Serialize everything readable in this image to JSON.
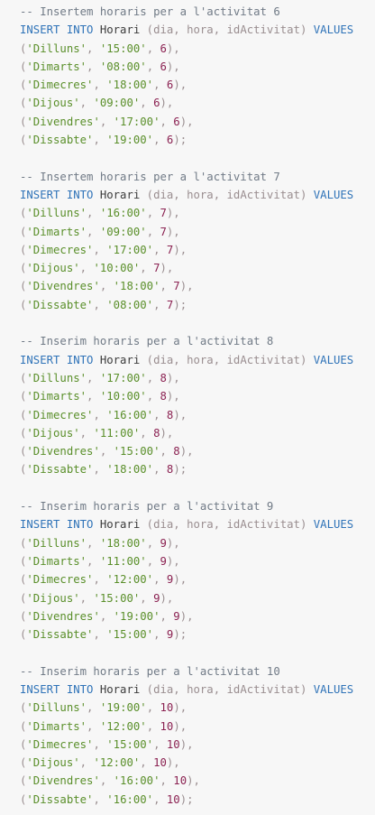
{
  "code": {
    "blocks": [
      {
        "comment": "-- Insertem horaris per a l'activitat 6",
        "insert_kw": "INSERT INTO",
        "table": "Horari",
        "columns": "(dia, hora, idActivitat)",
        "values_kw": "VALUES",
        "rows": [
          {
            "day": "'Dilluns'",
            "hour": "'15:00'",
            "id": "6",
            "end": "),"
          },
          {
            "day": "'Dimarts'",
            "hour": "'08:00'",
            "id": "6",
            "end": "),"
          },
          {
            "day": "'Dimecres'",
            "hour": "'18:00'",
            "id": "6",
            "end": "),"
          },
          {
            "day": "'Dijous'",
            "hour": "'09:00'",
            "id": "6",
            "end": "),"
          },
          {
            "day": "'Divendres'",
            "hour": "'17:00'",
            "id": "6",
            "end": "),"
          },
          {
            "day": "'Dissabte'",
            "hour": "'19:00'",
            "id": "6",
            "end": ");"
          }
        ]
      },
      {
        "comment": "-- Insertem horaris per a l'activitat 7",
        "insert_kw": "INSERT INTO",
        "table": "Horari",
        "columns": "(dia, hora, idActivitat)",
        "values_kw": "VALUES",
        "rows": [
          {
            "day": "'Dilluns'",
            "hour": "'16:00'",
            "id": "7",
            "end": "),"
          },
          {
            "day": "'Dimarts'",
            "hour": "'09:00'",
            "id": "7",
            "end": "),"
          },
          {
            "day": "'Dimecres'",
            "hour": "'17:00'",
            "id": "7",
            "end": "),"
          },
          {
            "day": "'Dijous'",
            "hour": "'10:00'",
            "id": "7",
            "end": "),"
          },
          {
            "day": "'Divendres'",
            "hour": "'18:00'",
            "id": "7",
            "end": "),"
          },
          {
            "day": "'Dissabte'",
            "hour": "'08:00'",
            "id": "7",
            "end": ");"
          }
        ]
      },
      {
        "comment": "-- Inserim horaris per a l'activitat 8",
        "insert_kw": "INSERT INTO",
        "table": "Horari",
        "columns": "(dia, hora, idActivitat)",
        "values_kw": "VALUES",
        "rows": [
          {
            "day": "'Dilluns'",
            "hour": "'17:00'",
            "id": "8",
            "end": "),"
          },
          {
            "day": "'Dimarts'",
            "hour": "'10:00'",
            "id": "8",
            "end": "),"
          },
          {
            "day": "'Dimecres'",
            "hour": "'16:00'",
            "id": "8",
            "end": "),"
          },
          {
            "day": "'Dijous'",
            "hour": "'11:00'",
            "id": "8",
            "end": "),"
          },
          {
            "day": "'Divendres'",
            "hour": "'15:00'",
            "id": "8",
            "end": "),"
          },
          {
            "day": "'Dissabte'",
            "hour": "'18:00'",
            "id": "8",
            "end": ");"
          }
        ]
      },
      {
        "comment": "-- Inserim horaris per a l'activitat 9",
        "insert_kw": "INSERT INTO",
        "table": "Horari",
        "columns": "(dia, hora, idActivitat)",
        "values_kw": "VALUES",
        "rows": [
          {
            "day": "'Dilluns'",
            "hour": "'18:00'",
            "id": "9",
            "end": "),"
          },
          {
            "day": "'Dimarts'",
            "hour": "'11:00'",
            "id": "9",
            "end": "),"
          },
          {
            "day": "'Dimecres'",
            "hour": "'12:00'",
            "id": "9",
            "end": "),"
          },
          {
            "day": "'Dijous'",
            "hour": "'15:00'",
            "id": "9",
            "end": "),"
          },
          {
            "day": "'Divendres'",
            "hour": "'19:00'",
            "id": "9",
            "end": "),"
          },
          {
            "day": "'Dissabte'",
            "hour": "'15:00'",
            "id": "9",
            "end": ");"
          }
        ]
      },
      {
        "comment": "-- Inserim horaris per a l'activitat 10",
        "insert_kw": "INSERT INTO",
        "table": "Horari",
        "columns": "(dia, hora, idActivitat)",
        "values_kw": "VALUES",
        "rows": [
          {
            "day": "'Dilluns'",
            "hour": "'19:00'",
            "id": "10",
            "end": "),"
          },
          {
            "day": "'Dimarts'",
            "hour": "'12:00'",
            "id": "10",
            "end": "),"
          },
          {
            "day": "'Dimecres'",
            "hour": "'15:00'",
            "id": "10",
            "end": "),"
          },
          {
            "day": "'Dijous'",
            "hour": "'12:00'",
            "id": "10",
            "end": "),"
          },
          {
            "day": "'Divendres'",
            "hour": "'16:00'",
            "id": "10",
            "end": "),"
          },
          {
            "day": "'Dissabte'",
            "hour": "'16:00'",
            "id": "10",
            "end": ");"
          }
        ]
      }
    ]
  },
  "colors": {
    "background": "#f7f7f7",
    "comment": "#707a86",
    "keyword": "#2f73b8",
    "string": "#5a8f2a",
    "number": "#8b2252"
  }
}
